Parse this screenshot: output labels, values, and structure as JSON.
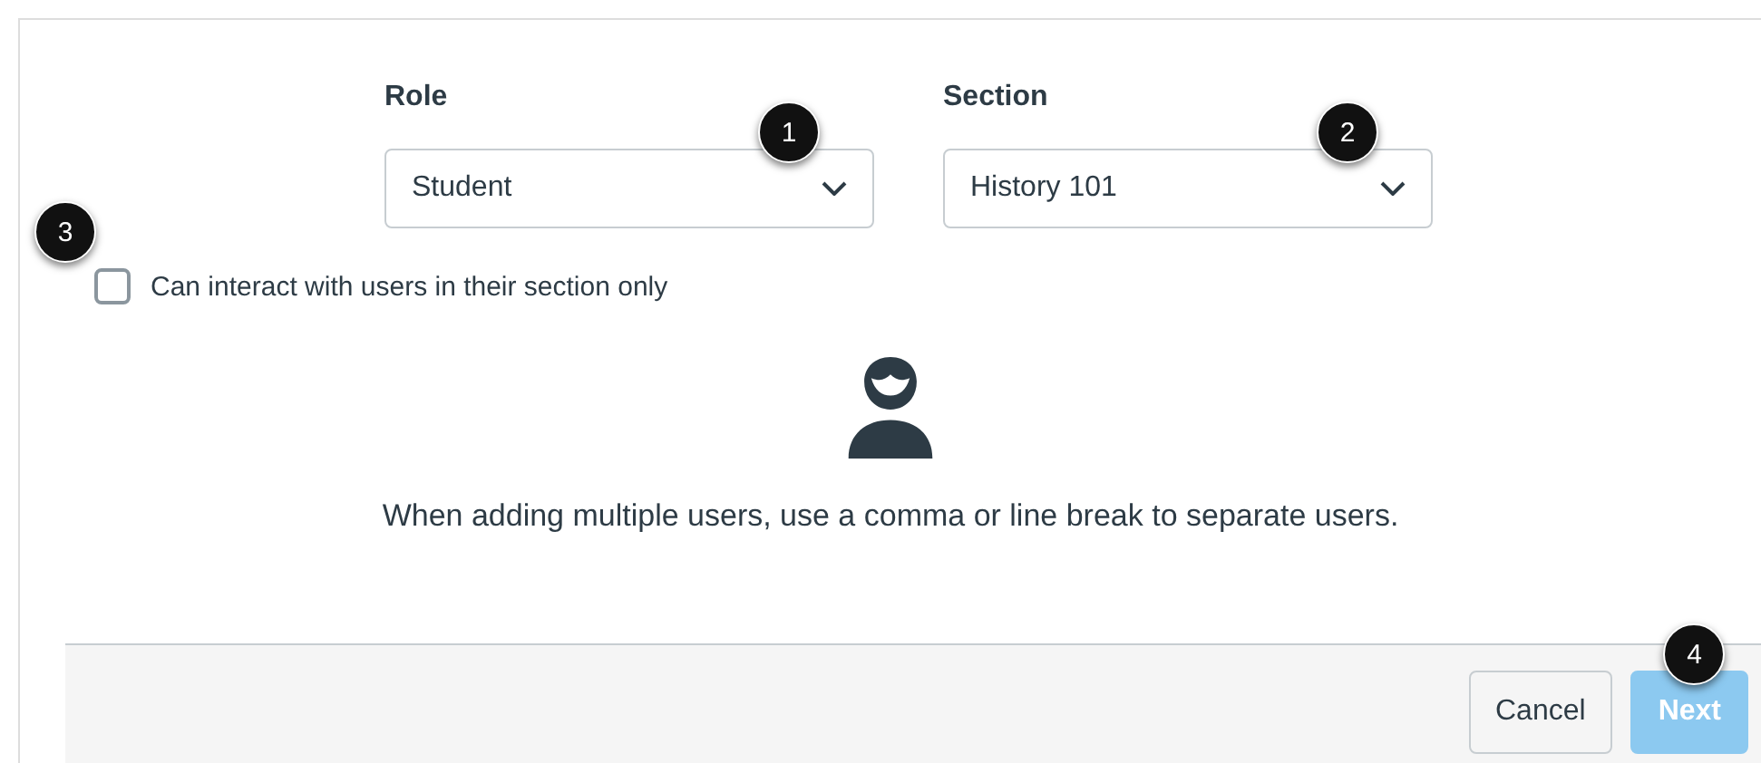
{
  "fields": [
    {
      "label": "Role",
      "value": "Student",
      "callout": "1"
    },
    {
      "label": "Section",
      "value": "History 101",
      "callout": "2"
    }
  ],
  "limit_checkbox": {
    "label": "Can interact with users in their section only",
    "checked": false,
    "callout": "3"
  },
  "message": "When adding multiple users, use a comma or line break to separate users.",
  "buttons": [
    {
      "label": "Cancel",
      "kind": "secondary",
      "disabled": false
    },
    {
      "label": "Next",
      "kind": "primary",
      "disabled": true,
      "callout": "4"
    }
  ]
}
